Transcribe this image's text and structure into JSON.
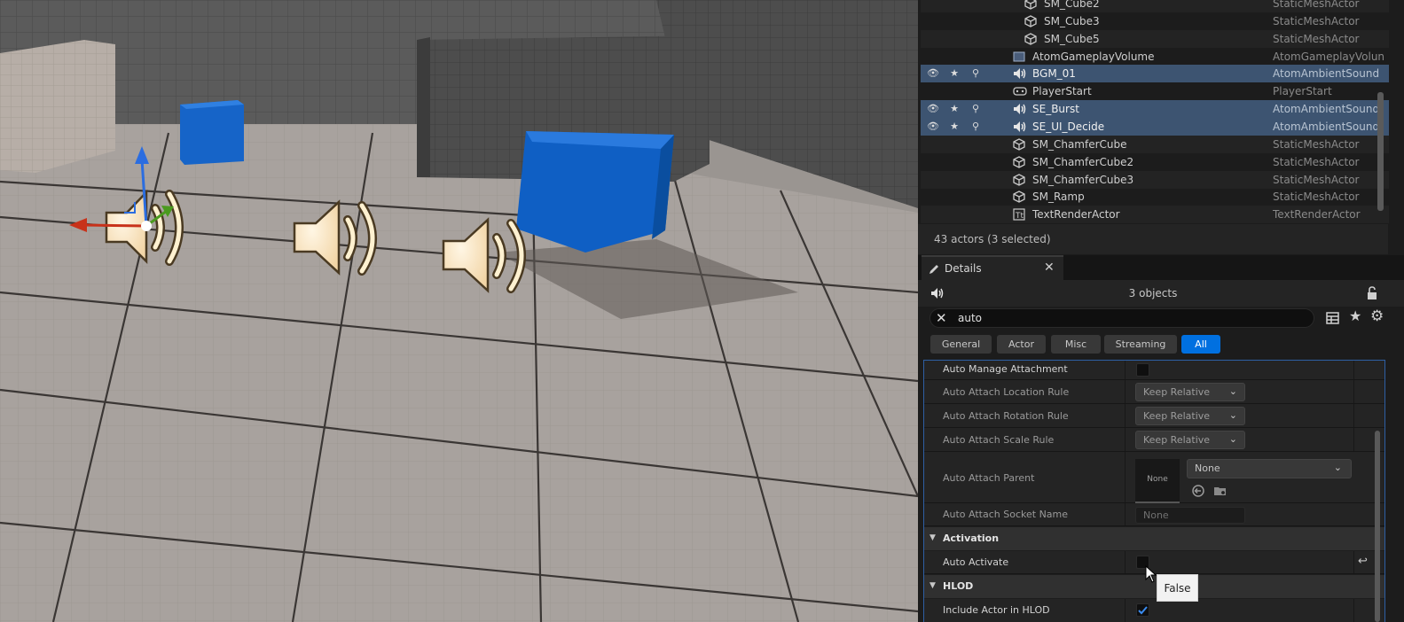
{
  "outliner": {
    "rows": [
      {
        "name": "SM_Cube2",
        "type": "StaticMeshActor",
        "icon": "cube-icon",
        "indent": 2,
        "selected": false
      },
      {
        "name": "SM_Cube3",
        "type": "StaticMeshActor",
        "icon": "cube-icon",
        "indent": 2,
        "selected": false
      },
      {
        "name": "SM_Cube5",
        "type": "StaticMeshActor",
        "icon": "cube-icon",
        "indent": 2,
        "selected": false
      },
      {
        "name": "AtomGameplayVolume",
        "type": "AtomGameplayVolun",
        "icon": "volume-icon",
        "indent": 1,
        "selected": false
      },
      {
        "name": "BGM_01",
        "type": "AtomAmbientSound",
        "icon": "speaker-icon",
        "indent": 1,
        "selected": true
      },
      {
        "name": "PlayerStart",
        "type": "PlayerStart",
        "icon": "player-start-icon",
        "indent": 1,
        "selected": false
      },
      {
        "name": "SE_Burst",
        "type": "AtomAmbientSound",
        "icon": "speaker-icon",
        "indent": 1,
        "selected": true
      },
      {
        "name": "SE_UI_Decide",
        "type": "AtomAmbientSound",
        "icon": "speaker-icon",
        "indent": 1,
        "selected": true
      },
      {
        "name": "SM_ChamferCube",
        "type": "StaticMeshActor",
        "icon": "cube-icon",
        "indent": 1,
        "selected": false
      },
      {
        "name": "SM_ChamferCube2",
        "type": "StaticMeshActor",
        "icon": "cube-icon",
        "indent": 1,
        "selected": false
      },
      {
        "name": "SM_ChamferCube3",
        "type": "StaticMeshActor",
        "icon": "cube-icon",
        "indent": 1,
        "selected": false
      },
      {
        "name": "SM_Ramp",
        "type": "StaticMeshActor",
        "icon": "cube-icon",
        "indent": 1,
        "selected": false
      },
      {
        "name": "TextRenderActor",
        "type": "TextRenderActor",
        "icon": "text-render-icon",
        "indent": 1,
        "selected": false
      }
    ],
    "footer": "43 actors (3 selected)"
  },
  "details": {
    "tab_label": "Details",
    "object_count": "3 objects",
    "search_value": "auto",
    "filters": [
      {
        "label": "General",
        "active": false
      },
      {
        "label": "Actor",
        "active": false
      },
      {
        "label": "Misc",
        "active": false
      },
      {
        "label": "Streaming",
        "active": false
      },
      {
        "label": "All",
        "active": true
      }
    ],
    "properties": {
      "auto_manage_attachment": "Auto Manage Attachment",
      "location_rule": {
        "label": "Auto Attach Location Rule",
        "value": "Keep Relative"
      },
      "rotation_rule": {
        "label": "Auto Attach Rotation Rule",
        "value": "Keep Relative"
      },
      "scale_rule": {
        "label": "Auto Attach Scale Rule",
        "value": "Keep Relative"
      },
      "parent": {
        "label": "Auto Attach Parent",
        "thumb": "None",
        "value": "None"
      },
      "socket": {
        "label": "Auto Attach Socket Name",
        "value": "None"
      },
      "activation_category": "Activation",
      "auto_activate": {
        "label": "Auto Activate",
        "checked": false
      },
      "hlod_category": "HLOD",
      "include_hlod": {
        "label": "Include Actor in HLOD",
        "checked": true
      }
    },
    "tooltip": "False"
  },
  "colors": {
    "selection": "#3d5471",
    "accent": "#0070e0",
    "cube": "#1368d0"
  }
}
